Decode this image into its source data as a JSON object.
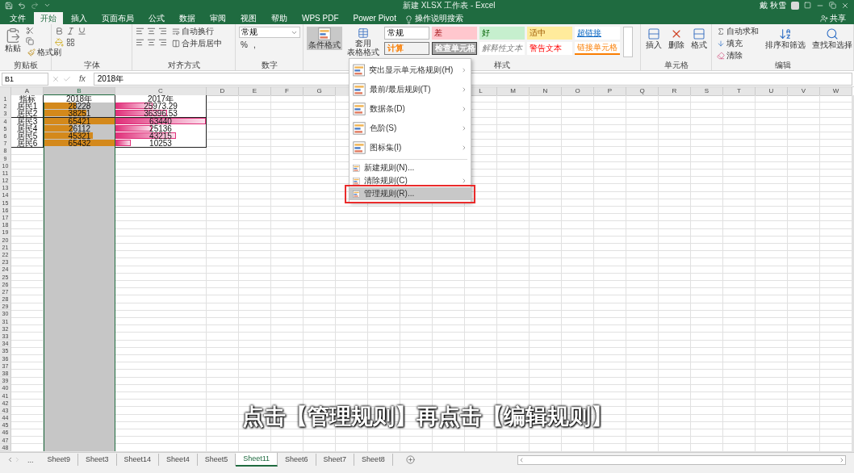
{
  "window": {
    "title": "新建 XLSX 工作表 - Excel",
    "user": "戴 秋雪"
  },
  "ribbon_tabs": [
    {
      "label": "文件",
      "selected": false
    },
    {
      "label": "开始",
      "selected": true
    },
    {
      "label": "插入",
      "selected": false
    },
    {
      "label": "页面布局",
      "selected": false
    },
    {
      "label": "公式",
      "selected": false
    },
    {
      "label": "数据",
      "selected": false
    },
    {
      "label": "审阅",
      "selected": false
    },
    {
      "label": "视图",
      "selected": false
    },
    {
      "label": "帮助",
      "selected": false
    },
    {
      "label": "WPS PDF",
      "selected": false
    },
    {
      "label": "Power Pivot",
      "selected": false
    }
  ],
  "tell_me": "操作说明搜索",
  "share": "共享",
  "clipboard": {
    "label": "剪贴板",
    "paste": "粘贴",
    "format_painter": "格式刷"
  },
  "font": {
    "label": "字体"
  },
  "alignment": {
    "label": "对齐方式",
    "wrap": "自动换行",
    "merge": "合并后居中"
  },
  "number": {
    "label": "数字",
    "format": "常规",
    "percent": "%",
    "comma": ","
  },
  "styles": {
    "label": "样式",
    "conditional": "条件格式",
    "table_format": [
      "套用",
      "表格格式"
    ],
    "gallery": [
      {
        "text": "常规",
        "kind": "normal"
      },
      {
        "text": "差",
        "kind": "bad"
      },
      {
        "text": "好",
        "kind": "good"
      },
      {
        "text": "适中",
        "kind": "neutral"
      },
      {
        "text": "超链接",
        "kind": "hyperlink"
      },
      {
        "text": "计算",
        "kind": "calculation"
      },
      {
        "text": "检查单元格",
        "kind": "check"
      },
      {
        "text": "解释性文本",
        "kind": "explanatory"
      },
      {
        "text": "警告文本",
        "kind": "warning"
      },
      {
        "text": "链接单元格",
        "kind": "linked"
      }
    ]
  },
  "cells": {
    "label": "单元格",
    "buttons": [
      "插入",
      "删除",
      "格式"
    ]
  },
  "editing": {
    "label": "编辑",
    "autosum": "自动求和",
    "fill": "填充",
    "clear": "清除",
    "sort": "排序和筛选",
    "find": "查找和选择"
  },
  "formula_bar": {
    "name_box": "B1",
    "fx": "fx",
    "value": "2018年"
  },
  "columns": [
    {
      "label": "A",
      "selected": false
    },
    {
      "label": "B",
      "selected": true
    },
    {
      "label": "C",
      "selected": false
    },
    {
      "label": "D",
      "selected": false
    },
    {
      "label": "E",
      "selected": false
    },
    {
      "label": "F",
      "selected": false
    },
    {
      "label": "G",
      "selected": false
    },
    {
      "label": "L",
      "selected": false
    },
    {
      "label": "M",
      "selected": false
    },
    {
      "label": "N",
      "selected": false
    },
    {
      "label": "O",
      "selected": false
    },
    {
      "label": "P",
      "selected": false
    },
    {
      "label": "Q",
      "selected": false
    },
    {
      "label": "R",
      "selected": false
    },
    {
      "label": "S",
      "selected": false
    },
    {
      "label": "T",
      "selected": false
    },
    {
      "label": "U",
      "selected": false
    },
    {
      "label": "V",
      "selected": false
    },
    {
      "label": "W",
      "selected": false
    }
  ],
  "row_numbers": [
    "1",
    "2",
    "3",
    "4",
    "5",
    "6",
    "7",
    "8",
    "9",
    "10",
    "11",
    "12",
    "13",
    "14",
    "15",
    "16",
    "17",
    "18",
    "19",
    "20",
    "21",
    "22",
    "23",
    "24",
    "25",
    "26",
    "27",
    "28",
    "29",
    "30",
    "31",
    "32",
    "33",
    "34",
    "35",
    "36",
    "37",
    "38",
    "39",
    "40",
    "41",
    "42",
    "43",
    "44",
    "45",
    "46",
    "47",
    "48"
  ],
  "table": {
    "rows": [
      [
        {
          "text": "指标",
          "kind": "text"
        },
        {
          "text": "2018年",
          "kind": "text"
        },
        {
          "text": "2017年",
          "kind": "text"
        }
      ],
      [
        {
          "text": "居民1",
          "kind": "text"
        },
        {
          "text": "28228",
          "kind": "solid_bar",
          "level": 0.45
        },
        {
          "text": "25973.29",
          "kind": "gradient_bar",
          "level": 0.41
        }
      ],
      [
        {
          "text": "居民2",
          "kind": "text"
        },
        {
          "text": "38251",
          "kind": "solid_bar",
          "level": 0.6
        },
        {
          "text": "36396.53",
          "kind": "gradient_bar",
          "level": 0.57
        }
      ],
      [
        {
          "text": "居民3",
          "kind": "text"
        },
        {
          "text": "65421",
          "kind": "solid_bar",
          "level": 1
        },
        {
          "text": "63440",
          "kind": "gradient_bar",
          "level": 1
        }
      ],
      [
        {
          "text": "居民4",
          "kind": "text"
        },
        {
          "text": "26112",
          "kind": "solid_bar",
          "level": 0.4
        },
        {
          "text": "25136",
          "kind": "gradient_bar",
          "level": 0.4
        }
      ],
      [
        {
          "text": "居民5",
          "kind": "text"
        },
        {
          "text": "45321",
          "kind": "solid_bar",
          "level": 0.69
        },
        {
          "text": "43215",
          "kind": "gradient_bar",
          "level": 0.67
        }
      ],
      [
        {
          "text": "居民6",
          "kind": "text"
        },
        {
          "text": "65432",
          "kind": "solid_bar",
          "level": 1
        },
        {
          "text": "10253",
          "kind": "gradient_bar",
          "level": 0.17
        }
      ]
    ]
  },
  "menu": {
    "items": [
      {
        "label": "突出显示单元格规则(H)",
        "kind": "large",
        "submenu": true,
        "selected": false,
        "annotated": false
      },
      {
        "label": "最前/最后规则(T)",
        "kind": "large",
        "submenu": true,
        "selected": false,
        "annotated": false
      },
      {
        "label": "数据条(D)",
        "kind": "large",
        "submenu": true,
        "selected": false,
        "annotated": false
      },
      {
        "label": "色阶(S)",
        "kind": "large",
        "submenu": true,
        "selected": false,
        "annotated": false
      },
      {
        "label": "图标集(I)",
        "kind": "large",
        "submenu": true,
        "selected": false,
        "annotated": false
      },
      {
        "label": "新建规则(N)...",
        "kind": "small",
        "submenu": false,
        "selected": false,
        "annotated": false
      },
      {
        "label": "清除规则(C)",
        "kind": "small",
        "submenu": true,
        "selected": false,
        "annotated": false
      },
      {
        "label": "管理规则(R)...",
        "kind": "small",
        "submenu": false,
        "selected": true,
        "annotated": true
      }
    ]
  },
  "sheet_tabs": {
    "more": "...",
    "tabs": [
      {
        "label": "Sheet9",
        "selected": false
      },
      {
        "label": "Sheet3",
        "selected": false
      },
      {
        "label": "Sheet14",
        "selected": false
      },
      {
        "label": "Sheet4",
        "selected": false
      },
      {
        "label": "Sheet5",
        "selected": false
      },
      {
        "label": "Sheet11",
        "selected": true
      },
      {
        "label": "Sheet6",
        "selected": false
      },
      {
        "label": "Sheet7",
        "selected": false
      },
      {
        "label": "Sheet8",
        "selected": false
      }
    ]
  },
  "caption": "点击【管理规则】再点击【编辑规则】"
}
